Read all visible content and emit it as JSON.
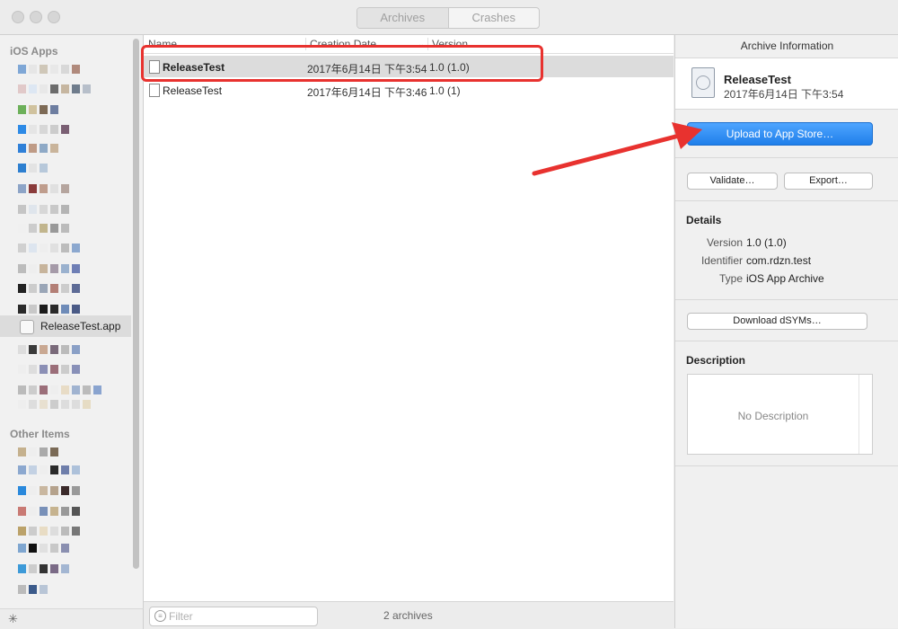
{
  "toolbar": {
    "tabs": [
      "Archives",
      "Crashes"
    ]
  },
  "sidebar": {
    "section_ios": "iOS Apps",
    "selected_app": "ReleaseTest.app",
    "section_other": "Other Items"
  },
  "list": {
    "columns": {
      "name": "Name",
      "date": "Creation Date",
      "version": "Version"
    },
    "rows": [
      {
        "name": "ReleaseTest",
        "date": "2017年6月14日 下午3:54",
        "version": "1.0 (1.0)"
      },
      {
        "name": "ReleaseTest",
        "date": "2017年6月14日 下午3:46",
        "version": "1.0 (1)"
      }
    ],
    "filter_placeholder": "Filter",
    "count": "2 archives"
  },
  "inspector": {
    "title": "Archive Information",
    "archive_name": "ReleaseTest",
    "archive_date": "2017年6月14日 下午3:54",
    "upload_label": "Upload to App Store…",
    "validate_label": "Validate…",
    "export_label": "Export…",
    "details_title": "Details",
    "details": {
      "version_key": "Version",
      "version": "1.0 (1.0)",
      "identifier_key": "Identifier",
      "identifier": "com.rdzn.test",
      "type_key": "Type",
      "type": "iOS App Archive"
    },
    "download_dsyms_label": "Download dSYMs…",
    "description_title": "Description",
    "description_placeholder": "No Description"
  },
  "colors": {
    "accent": "#1f7fea",
    "annotation": "#e8322f"
  }
}
